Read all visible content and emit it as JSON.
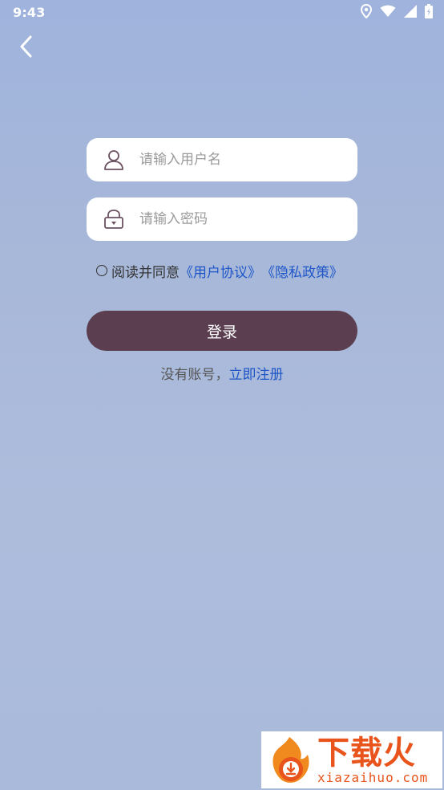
{
  "status_bar": {
    "time": "9:43",
    "icons": [
      "location-icon",
      "wifi-icon",
      "signal-icon",
      "battery-icon"
    ]
  },
  "nav": {
    "back_icon": "chevron-left-icon"
  },
  "login_form": {
    "username_placeholder": "请输入用户名",
    "username_icon": "user-icon",
    "password_placeholder": "请输入密码",
    "password_icon": "lock-icon",
    "agreement": {
      "prefix": "阅读并同意",
      "user_agreement": "《用户协议》",
      "privacy_policy": "《隐私政策》"
    },
    "login_label": "登录",
    "register_prompt": "没有账号，",
    "register_link": "立即注册"
  },
  "watermark": {
    "title": "下载火",
    "subtitle": "xiazaihuo.com"
  },
  "colors": {
    "accent_button": "#5b3f50",
    "link": "#1e56c8",
    "background": "#a9badb",
    "watermark": "#e8541c"
  }
}
